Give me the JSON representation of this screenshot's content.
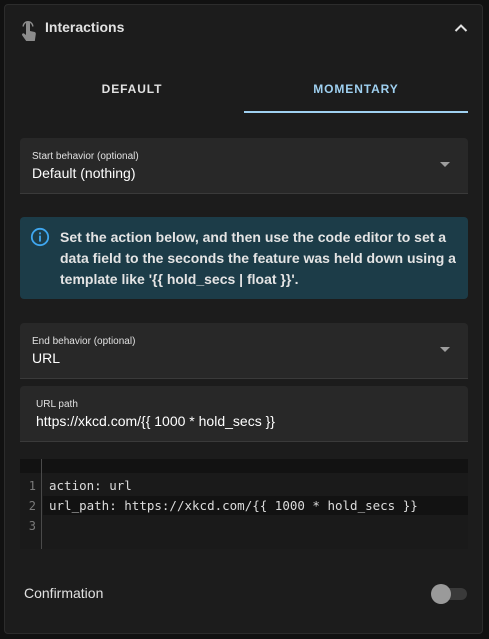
{
  "header": {
    "title": "Interactions",
    "icon": "touch-hand-icon",
    "collapse_icon": "chevron-up-icon"
  },
  "tabs": [
    {
      "label": "DEFAULT",
      "active": false
    },
    {
      "label": "MOMENTARY",
      "active": true
    }
  ],
  "start_behavior": {
    "label": "Start behavior (optional)",
    "value": "Default (nothing)"
  },
  "info": {
    "icon": "info-circle-icon",
    "text": "Set the action below, and then use the code editor to set a data field to the seconds the feature was held down using a template like '{{ hold_secs | float }}'."
  },
  "end_behavior": {
    "label": "End behavior (optional)",
    "value": "URL"
  },
  "url_path": {
    "label": "URL path",
    "value": "https://xkcd.com/{{ 1000 * hold_secs }}"
  },
  "code_editor": {
    "lines": [
      {
        "num": "1",
        "key": "action",
        "value": "url"
      },
      {
        "num": "2",
        "key": "url_path",
        "value": "https://xkcd.com/{{ 1000 * hold_secs }}"
      },
      {
        "num": "3",
        "key": "",
        "value": ""
      }
    ]
  },
  "confirmation": {
    "label": "Confirmation",
    "enabled": false
  },
  "colors": {
    "accent": "#9fd0f0",
    "panel": "#1c1c1c",
    "field": "#282828",
    "info_bg": "#1c3c48"
  }
}
